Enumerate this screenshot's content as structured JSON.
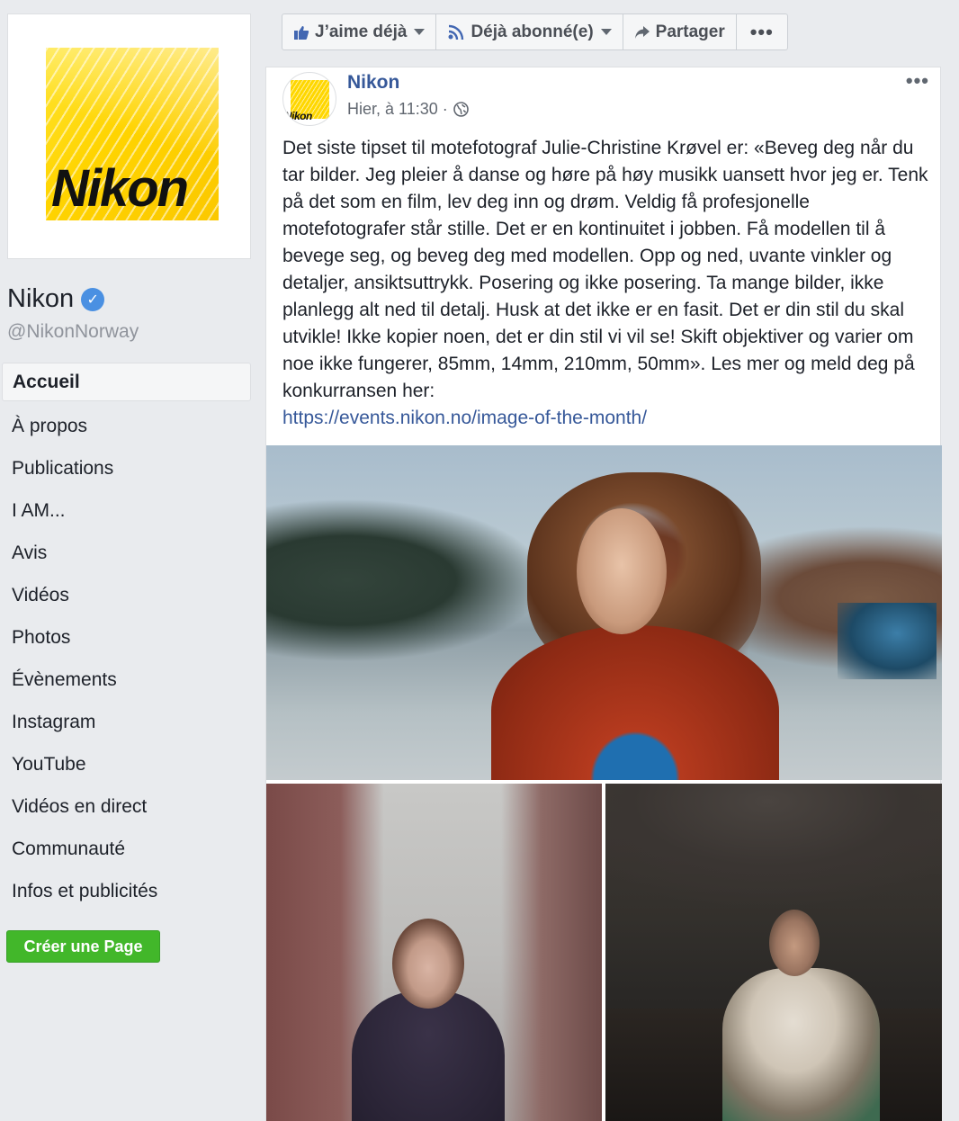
{
  "sidebar": {
    "logo_text": "Nikon",
    "page_name": "Nikon",
    "verified_icon": "check-badge-icon",
    "handle": "@NikonNorway",
    "nav": [
      {
        "label": "Accueil",
        "active": true
      },
      {
        "label": "À propos"
      },
      {
        "label": "Publications"
      },
      {
        "label": "I AM..."
      },
      {
        "label": "Avis"
      },
      {
        "label": "Vidéos"
      },
      {
        "label": "Photos"
      },
      {
        "label": "Évènements"
      },
      {
        "label": "Instagram"
      },
      {
        "label": "YouTube"
      },
      {
        "label": "Vidéos en direct"
      },
      {
        "label": "Communauté"
      },
      {
        "label": "Infos et publicités"
      }
    ],
    "create_page_label": "Créer une Page"
  },
  "actionbar": {
    "like_label": "J’aime déjà",
    "follow_label": "Déjà abonné(e)",
    "share_label": "Partager",
    "more_label": "•••"
  },
  "post": {
    "author": "Nikon",
    "avatar_text": "Nikon",
    "timestamp": "Hier, à 11:30 ·",
    "menu_label": "•••",
    "text": "Det siste tipset til motefotograf Julie-Christine Krøvel er: «Beveg deg når du tar bilder. Jeg pleier å danse og høre på høy musikk uansett hvor jeg er. Tenk på det som en film, lev deg inn og drøm. Veldig få profesjonelle motefotografer står stille. Det er en kontinuitet i jobben. Få modellen til å bevege seg, og beveg deg med modellen. Opp og ned, uvante vinkler og detaljer, ansiktsuttrykk. Posering og ikke posering. Ta mange bilder, ikke planlegg alt ned til detalj. Husk at det ikke er en fasit. Det er din stil du skal utvikle! Ikke kopier noen, det er din stil vi vil se! Skift objektiver og varier om noe ikke fungerer, 85mm, 14mm, 210mm, 50mm». Les mer og meld deg på konkurransen her:",
    "link": "https://events.nikon.no/image-of-the-month/"
  },
  "colors": {
    "link": "#365899",
    "brand_yellow": "#ffd400",
    "create_green": "#42b72a",
    "verified_blue": "#4a90e2"
  }
}
